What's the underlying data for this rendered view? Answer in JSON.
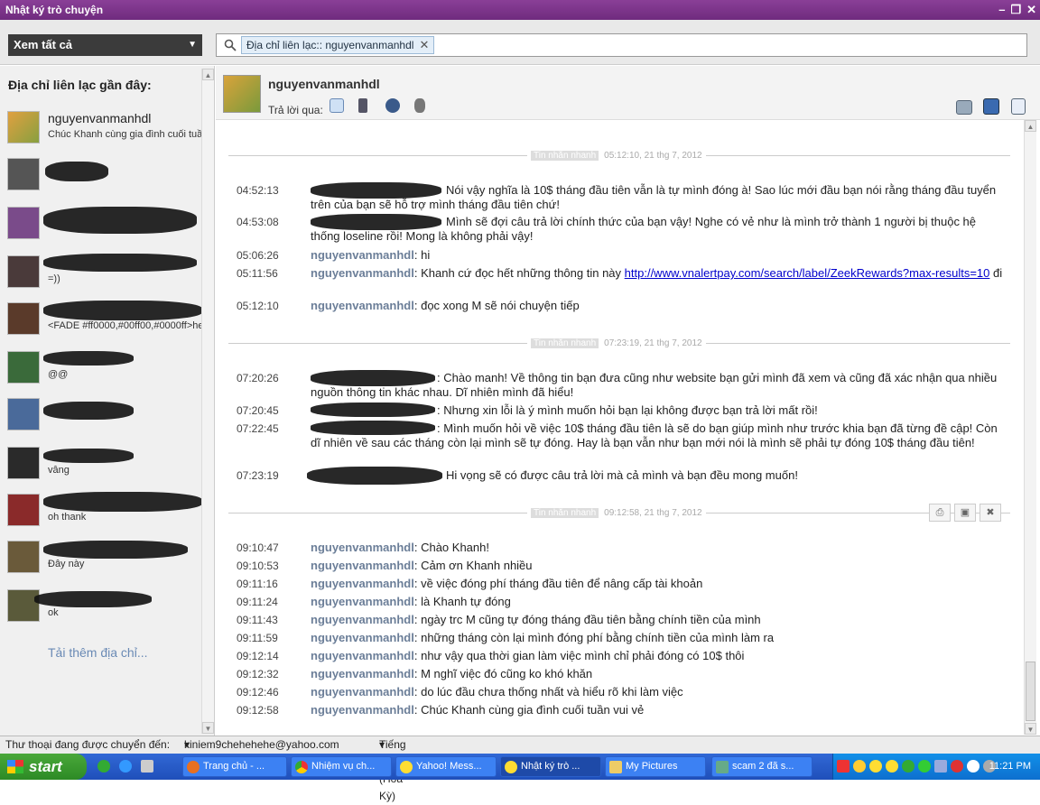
{
  "window": {
    "title": "Nhật ký trò chuyện"
  },
  "toolbar": {
    "view_label": "Xem tất cả",
    "search_chip": "Địa chỉ liên lạc:: nguyenvanmanhdl"
  },
  "sidebar": {
    "heading": "Địa chỉ liên lạc gần đây:",
    "contacts": [
      {
        "name": "nguyenvanmanhdl",
        "status": "Chúc Khanh cùng gia đình cuối tuần"
      },
      {
        "name": "",
        "status": ""
      },
      {
        "name": "",
        "status": ""
      },
      {
        "name": "",
        "status": "=))"
      },
      {
        "name": "",
        "status": "<FADE #ff0000,#00ff00,#0000ff>he"
      },
      {
        "name": "",
        "status": "@@"
      },
      {
        "name": "",
        "status": ""
      },
      {
        "name": "",
        "status": "vâng"
      },
      {
        "name": "",
        "status": "oh thank"
      },
      {
        "name": "",
        "status": "Đây này"
      },
      {
        "name": "",
        "status": "ok"
      }
    ],
    "load_more": "Tải thêm địa chỉ..."
  },
  "chat_header": {
    "name": "nguyenvanmanhdl",
    "reply_via": "Trả lời qua:"
  },
  "sessions": [
    {
      "tag": "Tin nhắn nhanh",
      "time": "05:12:10, 21 thg 7, 2012"
    },
    {
      "tag": "Tin nhắn nhanh",
      "time": "07:23:19, 21 thg 7, 2012"
    },
    {
      "tag": "Tin nhắn nhanh",
      "time": "09:12:58, 21 thg 7, 2012"
    }
  ],
  "messages": [
    {
      "time": "04:52:13",
      "user": "",
      "text": "Nói vậy nghĩa là 10$ tháng đầu tiên vẫn là tự mình đóng à! Sao lúc mới đầu bạn nói rằng tháng đầu tuyển trên của bạn sẽ hỗ trợ mình tháng đầu tiên chứ!"
    },
    {
      "time": "04:53:08",
      "user": "",
      "text": "Mình sẽ đợi câu trả lời chính thức của bạn vậy! Nghe có vẻ như là mình trở thành 1 người bị thuộc hệ thống loseline rồi! Mong là không phải vậy!"
    },
    {
      "time": "05:06:26",
      "user": "nguyenvanmanhdl",
      "text": ": hi"
    },
    {
      "time": "05:11:56",
      "user": "nguyenvanmanhdl",
      "text": ": Khanh cứ đọc hết những thông tin này ",
      "link": "http://www.vnalertpay.com/search/label/ZeekRewards?max-results=10",
      "after": " đi"
    },
    {
      "time": "05:12:10",
      "user": "nguyenvanmanhdl",
      "text": ": đọc xong M sẽ nói chuyện tiếp"
    },
    {
      "time": "07:20:26",
      "user": "",
      "text": ": Chào manh! Về thông tin bạn đưa cũng như website bạn gửi mình đã xem và cũng đã xác nhận qua nhiều nguồn thông tin khác nhau. Dĩ nhiên mình đã hiểu!"
    },
    {
      "time": "07:20:45",
      "user": "",
      "text": ": Nhưng xin lỗi là ý mình muốn hỏi bạn lại không được bạn trả lời mất rồi!"
    },
    {
      "time": "07:22:45",
      "user": "",
      "text": ": Mình muốn hỏi về việc 10$ tháng đầu tiên là sẽ do bạn giúp mình như trước khia bạn đã từng đề cập! Còn dĩ nhiên về sau các tháng còn lại mình sẽ tự đóng. Hay là bạn vẫn như bạn mới nói là mình sẽ phải tự đóng 10$ tháng đầu tiên!"
    },
    {
      "time": "07:23:19",
      "user": "",
      "text": "Hi vọng sẽ có được câu trả lời mà cả mình và bạn đều mong muốn!"
    },
    {
      "time": "09:10:47",
      "user": "nguyenvanmanhdl",
      "text": ": Chào Khanh!"
    },
    {
      "time": "09:10:53",
      "user": "nguyenvanmanhdl",
      "text": ": Cảm ơn Khanh nhiều"
    },
    {
      "time": "09:11:16",
      "user": "nguyenvanmanhdl",
      "text": ": về việc đóng phí tháng đầu tiên để nâng cấp tài khoản"
    },
    {
      "time": "09:11:24",
      "user": "nguyenvanmanhdl",
      "text": ": là Khanh tự đóng"
    },
    {
      "time": "09:11:43",
      "user": "nguyenvanmanhdl",
      "text": ": ngày trc M cũng tự đóng tháng đầu tiên bằng chính tiền của mình"
    },
    {
      "time": "09:11:59",
      "user": "nguyenvanmanhdl",
      "text": ": những tháng còn lại mình đóng phí bằng chính tiền của mình làm ra"
    },
    {
      "time": "09:12:14",
      "user": "nguyenvanmanhdl",
      "text": ": như vậy qua thời gian làm việc mình chỉ phải đóng có 10$ thôi"
    },
    {
      "time": "09:12:32",
      "user": "nguyenvanmanhdl",
      "text": ": M nghĩ việc đó cũng ko khó khăn"
    },
    {
      "time": "09:12:46",
      "user": "nguyenvanmanhdl",
      "text": ": do lúc đầu chưa thống nhất và hiểu rõ khi làm việc"
    },
    {
      "time": "09:12:58",
      "user": "nguyenvanmanhdl",
      "text": ": Chúc Khanh cùng gia đình cuối tuần vui vẻ"
    }
  ],
  "statusbar": {
    "forward_label": "Thư thoại đang được chuyển đến:",
    "forward_value": "kiniem9chehehehe@yahoo.com",
    "language": "Tiếng Anh (Hoa Kỳ)"
  },
  "taskbar": {
    "start": "start",
    "items": [
      "Trang chủ - ...",
      "Nhiệm vụ ch...",
      "Yahoo! Mess...",
      "Nhật ký trò ...",
      "My Pictures",
      "scam 2 đã s..."
    ],
    "clock": "11:21 PM"
  },
  "colors": {
    "titlebar": "#7a3389",
    "username": "#6b7e98",
    "link": "#0000cc",
    "taskbar": "#245edb"
  }
}
